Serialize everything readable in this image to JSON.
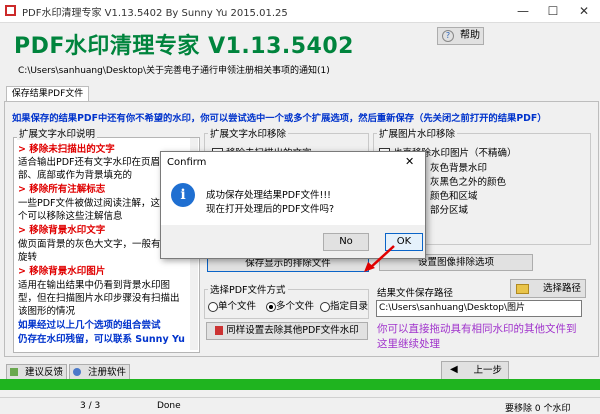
{
  "window": {
    "title": "PDF水印清理专家 V1.13.5402 By Sunny Yu 2015.01.25",
    "min": "—",
    "max": "☐",
    "close": "✕"
  },
  "header": {
    "app_name": "PDF水印清理专家 V1.13.5402",
    "help_label": "帮助"
  },
  "current_file": "C:\\Users\\sanhuang\\Desktop\\关于完善电子通行申领注册相关事项的通知(1)",
  "tabs": [
    {
      "label": "保存结果PDF文件"
    }
  ],
  "notice": "如果保存的结果PDF中还有你不希望的水印，你可以尝试选中一个或多个扩展选项，然后重新保存（先关闭之前打开的结果PDF）",
  "explain": {
    "title": "扩展文字水印说明",
    "lines": [
      {
        "text": "> 移除未扫描出的文字",
        "style": "red"
      },
      {
        "text": "  适合输出PDF还有文字水印在页眉",
        "style": "plain"
      },
      {
        "text": "  部、底部或作为背景填充的",
        "style": "plain"
      },
      {
        "text": "> 移除所有注解标志",
        "style": "red"
      },
      {
        "text": "  一些PDF文件被做过阅读注解，这",
        "style": "plain"
      },
      {
        "text": "  个可以移除这些注解信息",
        "style": "plain"
      },
      {
        "text": "> 移除背景水印文字",
        "style": "red"
      },
      {
        "text": "  做页面背景的灰色大文字，一般有",
        "style": "plain"
      },
      {
        "text": "  旋转",
        "style": "plain"
      },
      {
        "text": "> 移除背景水印图片",
        "style": "red"
      },
      {
        "text": "  适用在输出结果中仍看到背景水印图",
        "style": "plain"
      },
      {
        "text": "  型，但在扫描图片水印步骤没有扫描出",
        "style": "plain"
      },
      {
        "text": "  该图形的情况",
        "style": "plain"
      },
      {
        "text": "如果经过以上几个选项的组合尝试",
        "style": "blue"
      },
      {
        "text": "仍存在水印残留，可以联系 Sunny Yu",
        "style": "blue"
      }
    ]
  },
  "text_group": {
    "title": "扩展文字水印移除",
    "options": [
      {
        "label": "移除未扫描出的文字",
        "checked": false
      }
    ]
  },
  "image_group": {
    "title": "扩展图片水印移除",
    "options": [
      {
        "label": "也直移除水印图片（不精确）",
        "checked": false
      },
      {
        "label": "灰色背景水印",
        "checked": false
      },
      {
        "label": "灰黑色之外的颜色",
        "checked": false
      },
      {
        "label": "颜色和区域",
        "checked": false
      },
      {
        "label": "部分区域",
        "checked": false
      }
    ],
    "button_label": "设置图像排除选项"
  },
  "save_button_label": "保存显示的排除文件",
  "save_mode": {
    "title": "选择PDF文件方式",
    "options": [
      {
        "label": "单个文件",
        "selected": false
      },
      {
        "label": "多个文件",
        "selected": true
      },
      {
        "label": "指定目录",
        "selected": false
      }
    ]
  },
  "batch_button_label": "同样设置去除其他PDF文件水印",
  "output": {
    "label": "结果文件保存路径",
    "choose_label": "选择路径",
    "path": "C:\\Users\\sanhuang\\Desktop\\图片"
  },
  "hint": "你可以直接拖动具有相同水印的其他文件到这里继续处理",
  "footer_buttons": {
    "feedback": "建议反馈",
    "register": "注册软件",
    "back": "上一步"
  },
  "dialog": {
    "title": "Confirm",
    "line1": "成功保存处理结果PDF文件!!!",
    "line2": "现在打开处理后的PDF文件吗?",
    "icon_glyph": "i",
    "no_label": "No",
    "yes_label": "OK"
  },
  "status": {
    "pages": "3 / 3",
    "state": "Done",
    "right": "要移除 0 个水印"
  },
  "colors": {
    "title_green": "#00843d",
    "accent_blue": "#0033cc",
    "red": "#e00000",
    "progress": "#1fb41f"
  }
}
